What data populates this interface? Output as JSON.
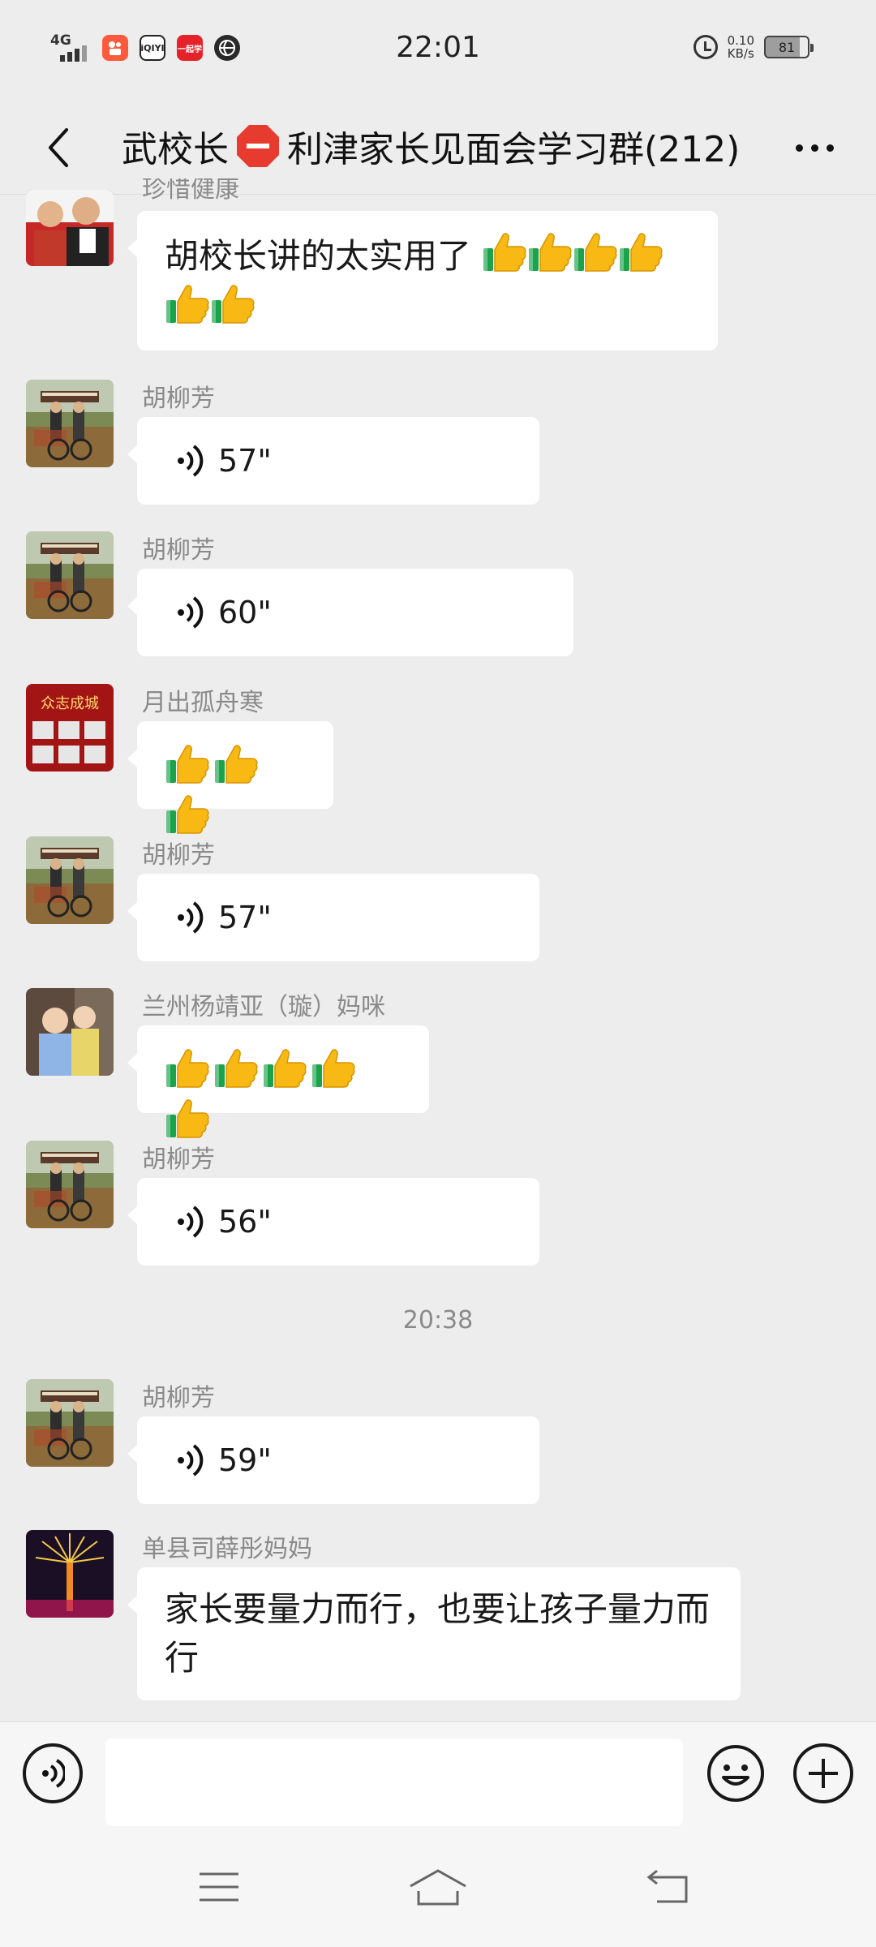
{
  "status_bar": {
    "network": "4G",
    "time": "22:01",
    "speed_value": "0.10",
    "speed_unit": "KB/s",
    "battery": "81",
    "app_icons": [
      "kuaishou-icon",
      "iqiyi-icon",
      "yiqixue-icon",
      "globe-icon"
    ],
    "app_labels": {
      "iqiyi": "iQIYI",
      "red": "一起学"
    }
  },
  "header": {
    "title_part1": "武校长",
    "title_part2": "利津家长见面会学习群(212)",
    "stop_icon": "stop-sign-icon"
  },
  "messages": [
    {
      "sender": "珍惜健康",
      "type": "text",
      "text": "胡校长讲的太实用了",
      "thumbs": 6
    },
    {
      "sender": "胡柳芳",
      "type": "voice",
      "duration": "57\""
    },
    {
      "sender": "胡柳芳",
      "type": "voice",
      "duration": "60\""
    },
    {
      "sender": "月出孤舟寒",
      "type": "emoji",
      "thumbs": 3,
      "avatar_caption": "众志成城"
    },
    {
      "sender": "胡柳芳",
      "type": "voice",
      "duration": "57\""
    },
    {
      "sender": "兰州杨靖亚（璇）妈咪",
      "type": "emoji",
      "thumbs": 5
    },
    {
      "sender": "胡柳芳",
      "type": "voice",
      "duration": "56\""
    },
    {
      "sender": "胡柳芳",
      "type": "voice",
      "duration": "59\""
    },
    {
      "sender": "单县司薛彤妈妈",
      "type": "text",
      "text": "家长要量力而行，也要让孩子量力而行"
    }
  ],
  "time_divider": "20:38",
  "input_bar": {
    "placeholder": ""
  },
  "colors": {
    "background": "#ededed",
    "bubble": "#ffffff",
    "meta_text": "#8a8a8a"
  }
}
